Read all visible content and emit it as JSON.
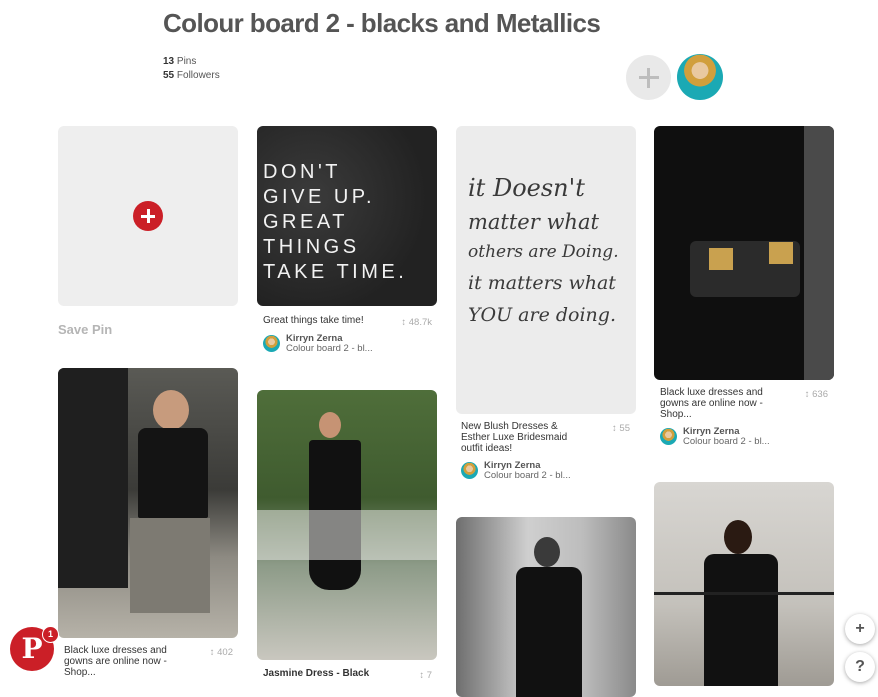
{
  "board": {
    "title": "Colour board 2 - blacks and Metallics",
    "pins_count": "13",
    "pins_label": " Pins",
    "followers_count": "55",
    "followers_label": " Followers"
  },
  "save_pin": {
    "label": "Save Pin"
  },
  "quote_pin_1": {
    "lines": [
      "DON'T",
      "GIVE UP.",
      "GREAT",
      "THINGS",
      "TAKE TIME."
    ]
  },
  "quote_pin_2": {
    "lines": [
      "it Doesn't",
      "matter what",
      "others are Doing.",
      "it matters what",
      "YOU are doing."
    ]
  },
  "pins": [
    {
      "desc": "Great things take time!",
      "count": "48.7k",
      "pinner": "Kirryn Zerna",
      "board": "Colour board 2 - bl..."
    },
    {
      "desc": "New Blush Dresses & Esther Luxe Bridesmaid outfit ideas!",
      "count": "55",
      "pinner": "Kirryn Zerna",
      "board": "Colour board 2 - bl..."
    },
    {
      "desc": "Black luxe dresses and gowns are online now - Shop...",
      "count": "636",
      "pinner": "Kirryn Zerna",
      "board": "Colour board 2 - bl..."
    },
    {
      "desc": "Black luxe dresses and gowns are online now - Shop...",
      "count": "402"
    },
    {
      "desc": "Jasmine Dress - Black",
      "count": "7"
    }
  ],
  "fab": {
    "plus": "+",
    "help": "?"
  },
  "notification_badge": "1",
  "colors": {
    "brand_red": "#cb1f27"
  }
}
